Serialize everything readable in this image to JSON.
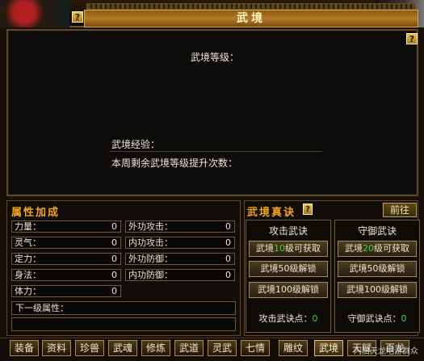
{
  "window": {
    "title": "武境",
    "help": "?"
  },
  "upper": {
    "level_label": "武境等级：",
    "exp_label": "武境经验：",
    "remain_label": "本周剩余武境等级提升次数："
  },
  "attributes": {
    "title": "属性加成",
    "items": [
      {
        "name": "力量：",
        "value": "0"
      },
      {
        "name": "灵气：",
        "value": "0"
      },
      {
        "name": "定力：",
        "value": "0"
      },
      {
        "name": "身法：",
        "value": "0"
      },
      {
        "name": "体力：",
        "value": "0"
      },
      {
        "name": "外功攻击：",
        "value": "0"
      },
      {
        "name": "内功攻击：",
        "value": "0"
      },
      {
        "name": "外功防御：",
        "value": "0"
      },
      {
        "name": "内功防御：",
        "value": "0"
      }
    ],
    "next_level_label": "下一级属性："
  },
  "zhenjue": {
    "title": "武境真诀",
    "goto_label": "前往",
    "attack": {
      "header": "攻击武诀",
      "btn1_prefix": "武境",
      "btn1_level": "10",
      "btn1_suffix": "级可获取",
      "btn2": "武境50级解锁",
      "btn3": "武境100级解锁",
      "points_label": "攻击武诀点：",
      "points_value": "0"
    },
    "defense": {
      "header": "守御武诀",
      "btn1_prefix": "武境",
      "btn1_level": "20",
      "btn1_suffix": "级可获取",
      "btn2": "武境50级解锁",
      "btn3": "武境100级解锁",
      "points_label": "守御武诀点：",
      "points_value": "0"
    }
  },
  "tabs": [
    "装备",
    "资料",
    "珍兽",
    "武魂",
    "修炼",
    "武道",
    "灵武",
    "七情",
    "雕纹",
    "武境",
    "天赋",
    "百龙"
  ],
  "active_tab": "武境",
  "watermark": "闪旧天龙吧游群众",
  "colors": {
    "accent": "#f0a428",
    "green": "#3fd23a",
    "frame_gold": "#c8a04a"
  }
}
